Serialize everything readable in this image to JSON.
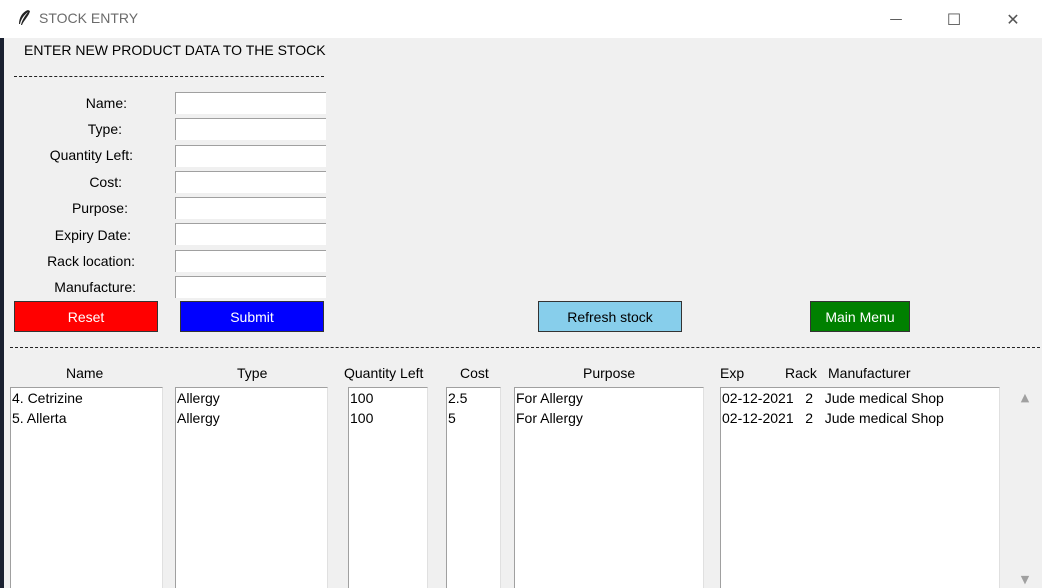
{
  "window": {
    "title": "STOCK ENTRY",
    "minimize_glyph": "—",
    "maximize_glyph": "☐",
    "close_glyph": "✕"
  },
  "form": {
    "heading": "ENTER NEW PRODUCT DATA TO THE STOCK",
    "fields": [
      {
        "label": "Name:",
        "value": ""
      },
      {
        "label": "Type:",
        "value": ""
      },
      {
        "label": "Quantity Left:",
        "value": ""
      },
      {
        "label": "Cost:",
        "value": ""
      },
      {
        "label": "Purpose:",
        "value": ""
      },
      {
        "label": "Expiry Date:",
        "value": ""
      },
      {
        "label": "Rack location:",
        "value": ""
      },
      {
        "label": "Manufacture:",
        "value": ""
      }
    ]
  },
  "buttons": {
    "reset": "Reset",
    "submit": "Submit",
    "refresh": "Refresh stock",
    "main_menu": "Main Menu"
  },
  "colors": {
    "reset": "#ff0000",
    "submit": "#0000ff",
    "refresh": "#87ceeb",
    "main_menu": "#008000"
  },
  "table": {
    "headers": {
      "name": "Name",
      "type": "Type",
      "quantity": "Quantity Left",
      "cost": "Cost",
      "purpose": "Purpose",
      "exp": "Exp",
      "rack": "Rack",
      "manufacturer": "Manufacturer"
    },
    "names": [
      "4. Cetrizine",
      "5. Allerta"
    ],
    "types": [
      "Allergy",
      "Allergy"
    ],
    "quantities": [
      "100",
      "100"
    ],
    "costs": [
      "2.5",
      "5"
    ],
    "purposes": [
      "For Allergy",
      "For Allergy"
    ],
    "details": [
      "02-12-2021   2   Jude medical Shop",
      "02-12-2021   2   Jude medical Shop"
    ]
  },
  "scrollbar": {
    "up_glyph": "▲",
    "down_glyph": "▼"
  }
}
